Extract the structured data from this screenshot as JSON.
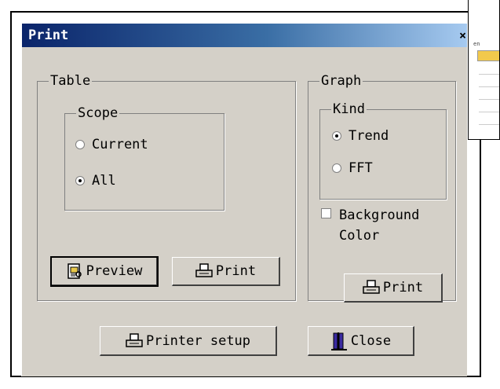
{
  "dialog": {
    "title": "Print",
    "close_glyph": "×"
  },
  "table_group": {
    "label": "Table",
    "scope": {
      "label": "Scope",
      "options": [
        {
          "label": "Current",
          "checked": false
        },
        {
          "label": "All",
          "checked": true
        }
      ]
    },
    "preview_label": "Preview",
    "print_label": "Print"
  },
  "graph_group": {
    "label": "Graph",
    "kind": {
      "label": "Kind",
      "options": [
        {
          "label": "Trend",
          "checked": true
        },
        {
          "label": "FFT",
          "checked": false
        }
      ]
    },
    "background_color_line1": "Background",
    "background_color_line2": "Color",
    "background_color_checked": false,
    "print_label": "Print"
  },
  "footer": {
    "printer_setup_label": "Printer setup",
    "close_label": "Close"
  },
  "icons": {
    "preview": "preview-icon",
    "printer": "printer-icon",
    "close": "close-door-icon"
  },
  "background_window": {
    "tiny_text": "en"
  }
}
